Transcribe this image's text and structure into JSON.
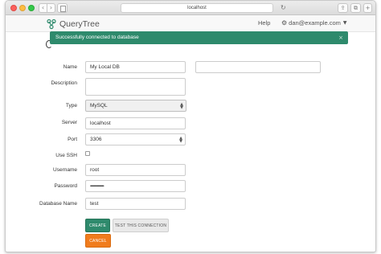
{
  "browser": {
    "url": "localhost",
    "nav_back": "‹",
    "nav_forward": "›",
    "reload": "↻",
    "share": "⇪",
    "tabs": "⧉",
    "new_tab": "+"
  },
  "navbar": {
    "brand": "QueryTree",
    "help": "Help",
    "user": "dan@example.com",
    "user_icon": "⚙",
    "user_caret": "▼"
  },
  "alert": {
    "message": "Successfully connected to database",
    "close": "×",
    "color": "#2e8a6c"
  },
  "form": {
    "name": {
      "label": "Name",
      "value": "My Local DB"
    },
    "description": {
      "label": "Description",
      "value": ""
    },
    "type": {
      "label": "Type",
      "value": "MySQL"
    },
    "server": {
      "label": "Server",
      "value": "localhost"
    },
    "port": {
      "label": "Port",
      "value": "3306"
    },
    "use_ssh": {
      "label": "Use SSH",
      "checked": false
    },
    "username": {
      "label": "Username",
      "value": "root"
    },
    "password": {
      "label": "Password",
      "value": "••••••••••••••••••"
    },
    "database_name": {
      "label": "Database Name",
      "value": "test"
    }
  },
  "buttons": {
    "create": "CREATE",
    "test": "TEST THIS CONNECTION",
    "cancel": "CANCEL"
  },
  "colors": {
    "primary": "#2e8a6c",
    "cancel": "#f07c1d"
  }
}
